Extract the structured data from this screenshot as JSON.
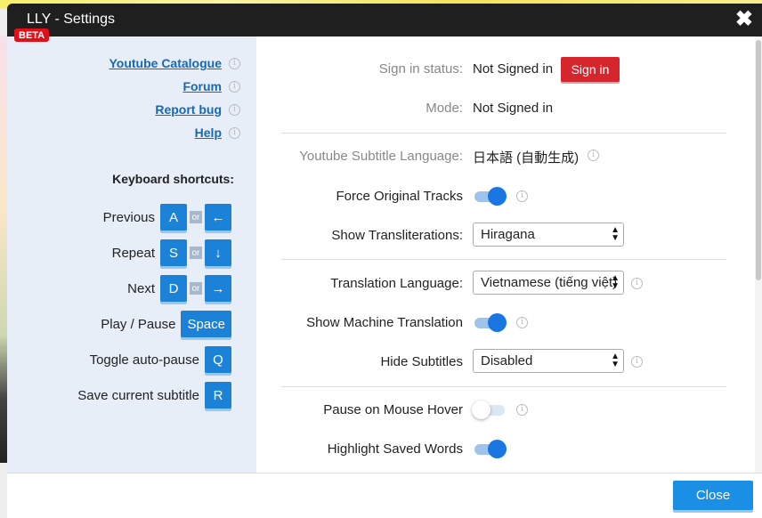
{
  "window": {
    "title": "LLY - Settings",
    "badge": "BETA",
    "close_glyph": "✖"
  },
  "sidebar": {
    "links": [
      {
        "label": "Youtube Catalogue"
      },
      {
        "label": "Forum"
      },
      {
        "label": "Report bug"
      },
      {
        "label": "Help"
      }
    ],
    "shortcuts_title": "Keyboard shortcuts:",
    "or_label": "or",
    "shortcuts": [
      {
        "label": "Previous",
        "key1": "A",
        "key2": "←"
      },
      {
        "label": "Repeat",
        "key1": "S",
        "key2": "↓"
      },
      {
        "label": "Next",
        "key1": "D",
        "key2": "→"
      },
      {
        "label": "Play / Pause",
        "key1": "Space"
      },
      {
        "label": "Toggle auto-pause",
        "key1": "Q"
      },
      {
        "label": "Save current subtitle",
        "key1": "R"
      }
    ]
  },
  "settings": {
    "sign_in_status": {
      "label": "Sign in status:",
      "value": "Not Signed in",
      "button": "Sign in"
    },
    "mode": {
      "label": "Mode:",
      "value": "Not Signed in"
    },
    "subtitle_language": {
      "label": "Youtube Subtitle Language:",
      "value": "日本語 (自動生成)"
    },
    "force_original_tracks": {
      "label": "Force Original Tracks",
      "on": true
    },
    "show_transliterations": {
      "label": "Show Transliterations:",
      "value": "Hiragana"
    },
    "translation_language": {
      "label": "Translation Language:",
      "value": "Vietnamese (tiếng việt)"
    },
    "show_machine_translation": {
      "label": "Show Machine Translation",
      "on": true
    },
    "hide_subtitles": {
      "label": "Hide Subtitles",
      "value": "Disabled"
    },
    "pause_on_hover": {
      "label": "Pause on Mouse Hover",
      "on": false
    },
    "highlight_saved_words": {
      "label": "Highlight Saved Words",
      "on": true
    }
  },
  "info_glyph": "i",
  "footer": {
    "close_label": "Close"
  },
  "colors": {
    "accent": "#1b82d8",
    "danger": "#d6262d",
    "sidebar_bg": "#e8eef8",
    "title_bar": "#1f1f1f"
  }
}
